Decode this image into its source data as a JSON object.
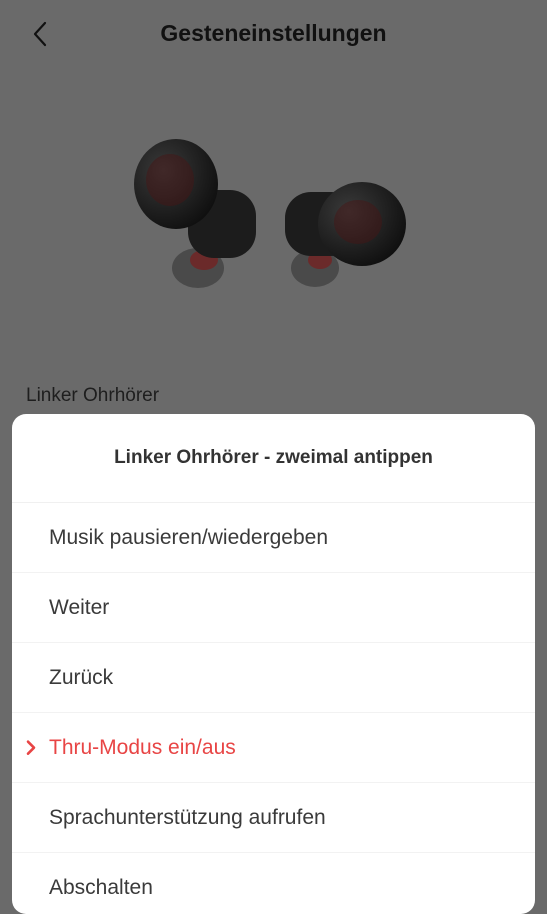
{
  "header": {
    "title": "Gesteneinstellungen",
    "back_icon": "chevron-left-icon"
  },
  "earbuds_image": {
    "icon": "earbuds-illustration",
    "color": "#1a1a1a"
  },
  "section": {
    "label": "Linker Ohrhörer"
  },
  "sheet": {
    "title": "Linker Ohrhörer - zweimal antippen",
    "options": [
      {
        "label": "Musik pausieren/wiedergeben",
        "selected": false
      },
      {
        "label": "Weiter",
        "selected": false
      },
      {
        "label": "Zurück",
        "selected": false
      },
      {
        "label": "Thru-Modus ein/aus",
        "selected": true
      },
      {
        "label": "Sprachunterstützung aufrufen",
        "selected": false
      },
      {
        "label": "Abschalten",
        "selected": false
      }
    ]
  },
  "colors": {
    "accent": "#e84545",
    "overlay_background": "#6a6a6a",
    "sheet_background": "#ffffff"
  }
}
